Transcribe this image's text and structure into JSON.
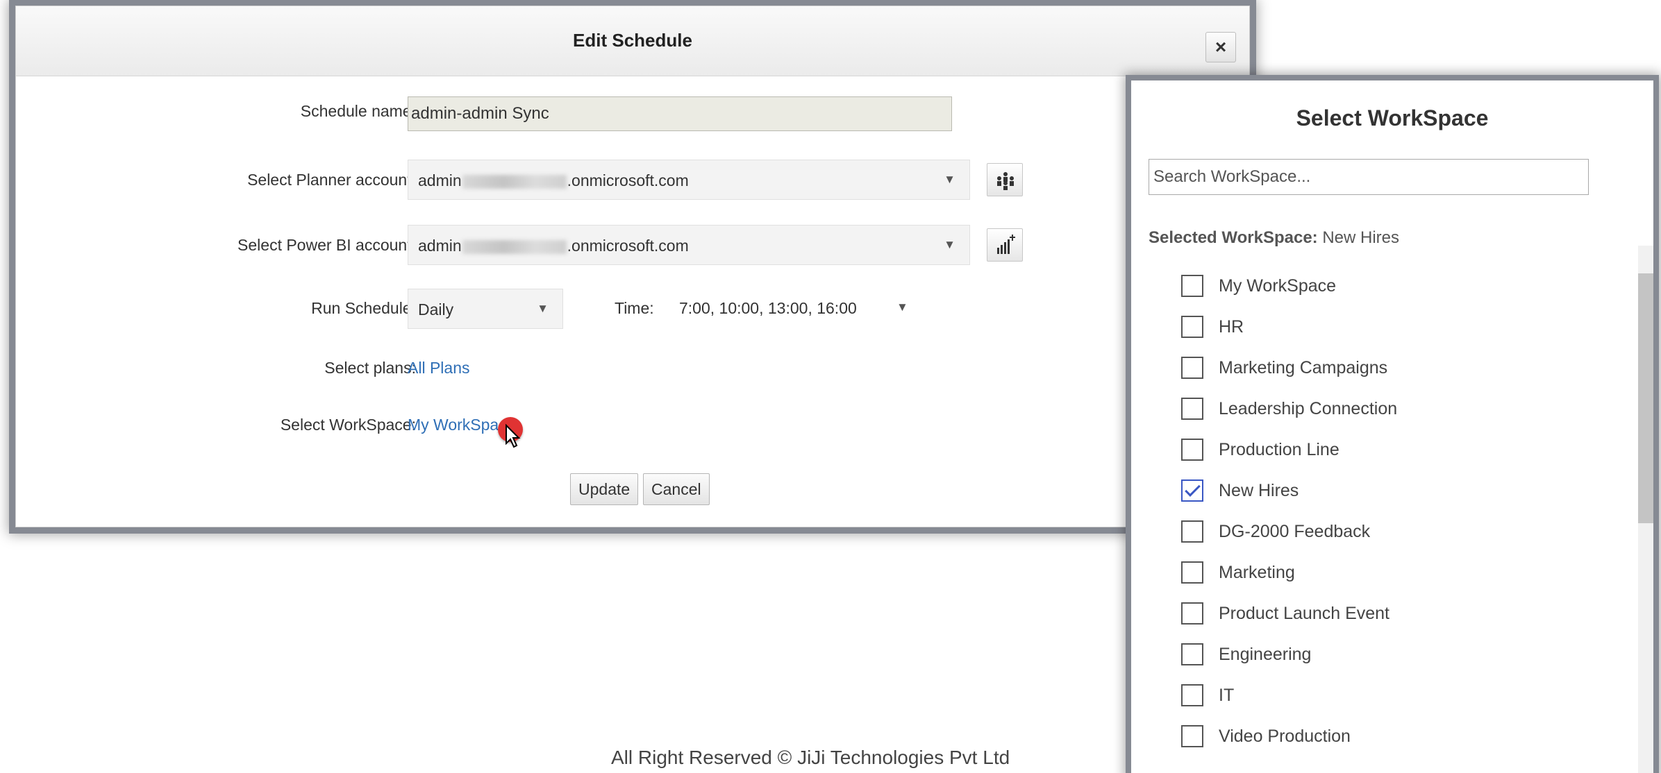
{
  "dialog": {
    "title": "Edit Schedule",
    "close_label": "×",
    "schedule_name_label": "Schedule name:",
    "schedule_name_value": "admin-admin Sync",
    "planner_label": "Select Planner account:",
    "planner_prefix": "admin",
    "planner_suffix": ".onmicrosoft.com",
    "powerbi_label": "Select Power BI account:",
    "powerbi_prefix": "admin",
    "powerbi_suffix": ".onmicrosoft.com",
    "run_schedule_label": "Run Schedule:",
    "run_schedule_value": "Daily",
    "time_label": "Time:",
    "time_value": "7:00, 10:00, 13:00, 16:00",
    "plans_label": "Select plans:",
    "plans_link": "All Plans",
    "workspace_label": "Select WorkSpace:",
    "workspace_link": "My WorkSpace",
    "update_label": "Update",
    "cancel_label": "Cancel"
  },
  "workspace_panel": {
    "title": "Select WorkSpace",
    "search_placeholder": "Search WorkSpace...",
    "selected_label": "Selected WorkSpace:",
    "selected_value": "New Hires",
    "items": [
      {
        "label": "My WorkSpace",
        "checked": false
      },
      {
        "label": "HR",
        "checked": false
      },
      {
        "label": "Marketing Campaigns",
        "checked": false
      },
      {
        "label": "Leadership Connection",
        "checked": false
      },
      {
        "label": "Production Line",
        "checked": false
      },
      {
        "label": "New Hires",
        "checked": true
      },
      {
        "label": "DG-2000 Feedback",
        "checked": false
      },
      {
        "label": "Marketing",
        "checked": false
      },
      {
        "label": "Product Launch Event",
        "checked": false
      },
      {
        "label": "Engineering",
        "checked": false
      },
      {
        "label": "IT",
        "checked": false
      },
      {
        "label": "Video Production",
        "checked": false
      }
    ]
  },
  "footer": {
    "text": "All Right Reserved © JiJi Technologies Pvt Ltd"
  },
  "colors": {
    "link": "#2f6fb6",
    "checkbox_checked": "#3a57c4",
    "cursor_dot": "#e03333"
  }
}
